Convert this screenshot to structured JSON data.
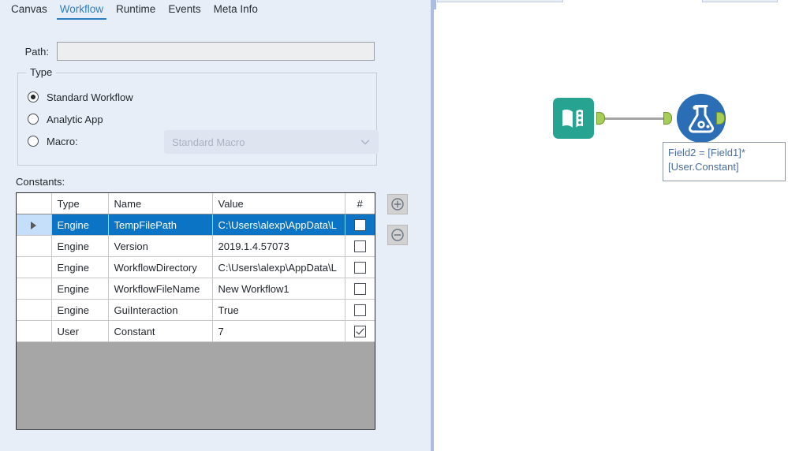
{
  "tabs": [
    {
      "label": "Canvas",
      "active": false
    },
    {
      "label": "Workflow",
      "active": true
    },
    {
      "label": "Runtime",
      "active": false
    },
    {
      "label": "Events",
      "active": false
    },
    {
      "label": "Meta Info",
      "active": false
    }
  ],
  "path": {
    "label": "Path:",
    "value": "",
    "placeholder": ""
  },
  "type_group": {
    "legend": "Type",
    "options": [
      {
        "label": "Standard Workflow",
        "selected": true
      },
      {
        "label": "Analytic App",
        "selected": false
      },
      {
        "label": "Macro:",
        "selected": false
      }
    ],
    "macro_select": {
      "value": "Standard Macro",
      "enabled": false
    }
  },
  "constants": {
    "label": "Constants:",
    "columns": [
      "",
      "Type",
      "Name",
      "Value",
      "#"
    ],
    "rows": [
      {
        "indicator": "▶",
        "type": "Engine",
        "name": "TempFilePath",
        "value": "C:\\Users\\alexp\\AppData\\L",
        "checked": false,
        "selected": true
      },
      {
        "indicator": "",
        "type": "Engine",
        "name": "Version",
        "value": "2019.1.4.57073",
        "checked": false,
        "selected": false
      },
      {
        "indicator": "",
        "type": "Engine",
        "name": "WorkflowDirectory",
        "value": "C:\\Users\\alexp\\AppData\\L",
        "checked": false,
        "selected": false
      },
      {
        "indicator": "",
        "type": "Engine",
        "name": "WorkflowFileName",
        "value": "New Workflow1",
        "checked": false,
        "selected": false
      },
      {
        "indicator": "",
        "type": "Engine",
        "name": "GuiInteraction",
        "value": "True",
        "checked": false,
        "selected": false
      },
      {
        "indicator": "",
        "type": "User",
        "name": "Constant",
        "value": "7",
        "checked": true,
        "selected": false
      }
    ],
    "add_button_title": "Add",
    "remove_button_title": "Remove"
  },
  "canvas": {
    "nodes": [
      {
        "id": "text-input",
        "tool": "Text Input",
        "color": "#27a391"
      },
      {
        "id": "formula",
        "tool": "Formula",
        "color": "#2c6eb5"
      }
    ],
    "annotation": "Field2 = [Field1]*\n[User.Constant]"
  },
  "colors": {
    "panel_bg": "#e8eef8",
    "accent_tab": "#2e7fc0",
    "row_selected": "#0b74c4",
    "connector": "#a6ce57",
    "annotation_text": "#4a6fa0"
  }
}
